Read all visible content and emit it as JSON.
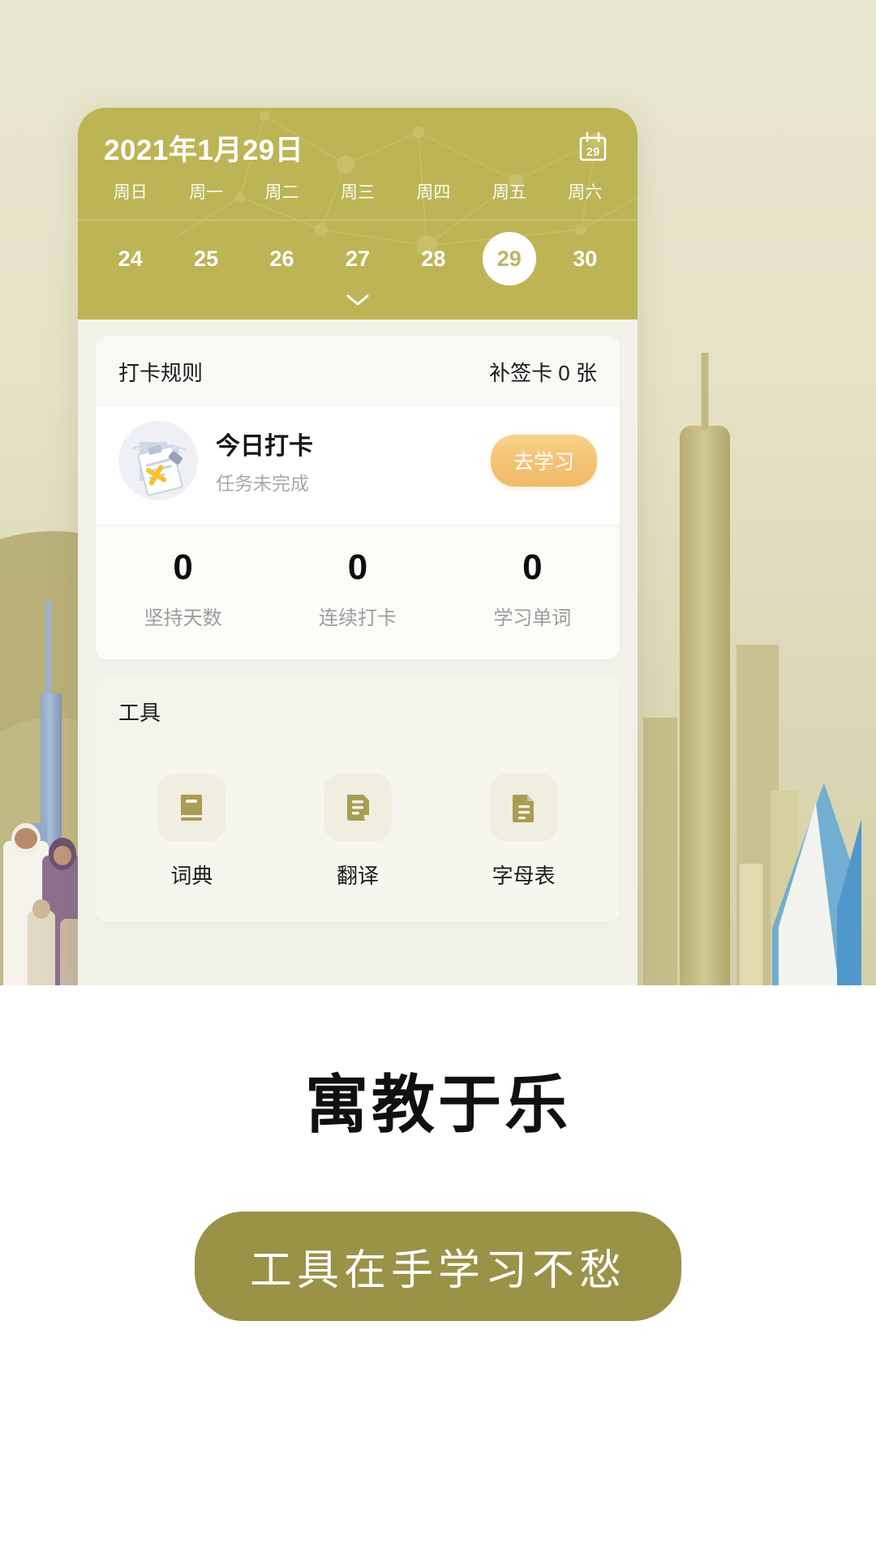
{
  "calendar": {
    "date_title": "2021年1月29日",
    "calendar_icon_day": "29",
    "weekdays": [
      "周日",
      "周一",
      "周二",
      "周三",
      "周四",
      "周五",
      "周六"
    ],
    "days": [
      "24",
      "25",
      "26",
      "27",
      "28",
      "29",
      "30"
    ],
    "selected_day": "29",
    "expand_icon": "chevron-down-icon",
    "header_color": "#bdb455"
  },
  "checkin_card": {
    "rules_label": "打卡规则",
    "makeup_cards_label": "补签卡 0 张",
    "today_title": "今日打卡",
    "today_status": "任务未完成",
    "action_label": "去学习",
    "action_color": "#f3c274",
    "stats": [
      {
        "value": "0",
        "label": "坚持天数"
      },
      {
        "value": "0",
        "label": "连续打卡"
      },
      {
        "value": "0",
        "label": "学习单词"
      }
    ]
  },
  "tools_card": {
    "title": "工具",
    "items": [
      {
        "label": "词典",
        "icon": "book-icon"
      },
      {
        "label": "翻译",
        "icon": "document-lines-icon"
      },
      {
        "label": "字母表",
        "icon": "document-text-icon"
      }
    ]
  },
  "promo": {
    "headline": "寓教于乐",
    "button_label": "工具在手学习不愁",
    "button_color": "#9a9247"
  }
}
